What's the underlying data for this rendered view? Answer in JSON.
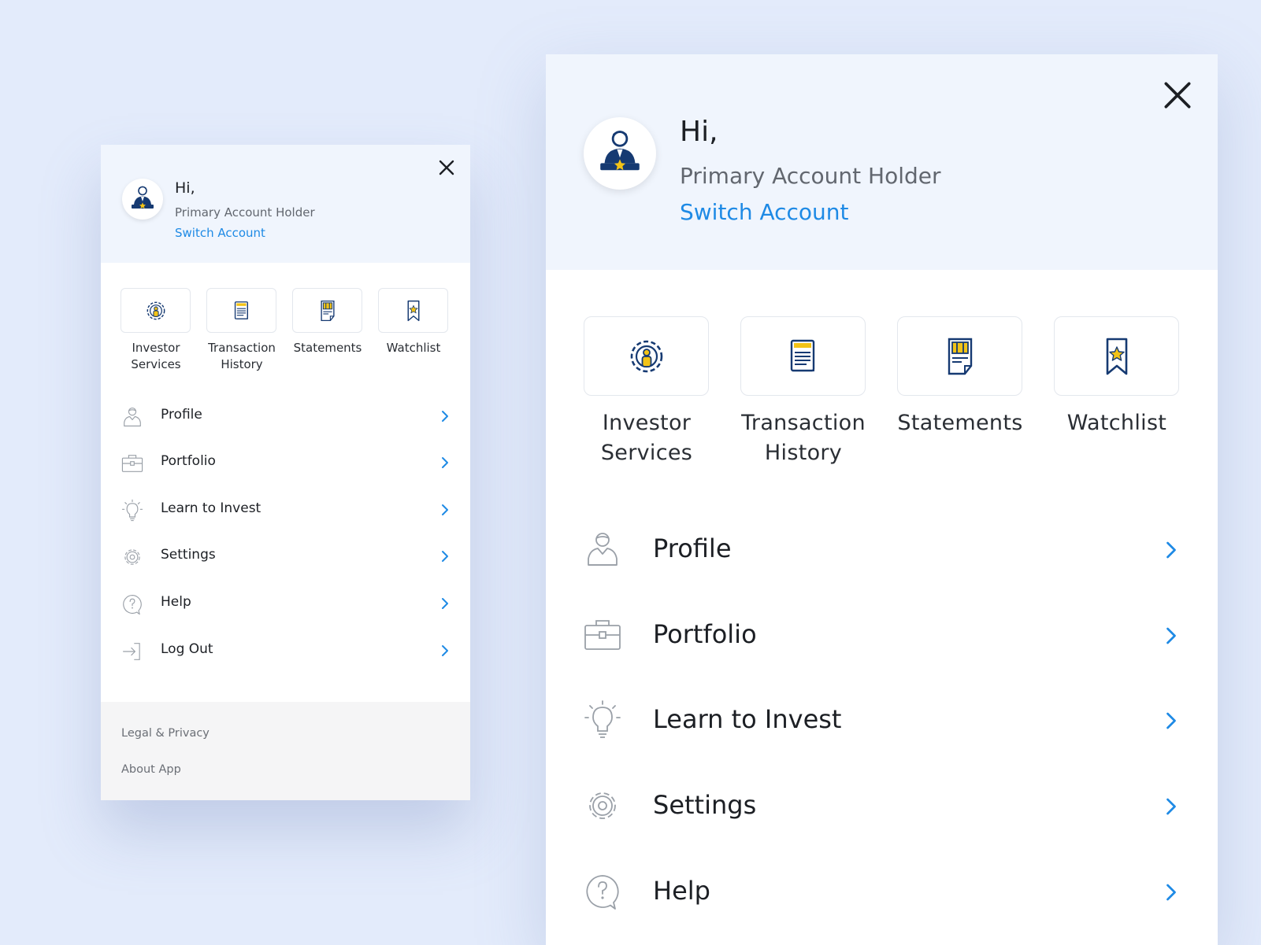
{
  "greeting": "Hi,",
  "account_role": "Primary Account Holder",
  "switch_account": "Switch Account",
  "quick_actions": [
    {
      "label": "Investor Services",
      "icon": "investor-services-icon"
    },
    {
      "label": "Transaction History",
      "icon": "transaction-history-icon"
    },
    {
      "label": "Statements",
      "icon": "statements-icon"
    },
    {
      "label": "Watchlist",
      "icon": "watchlist-icon"
    }
  ],
  "menu": [
    {
      "label": "Profile",
      "icon": "profile-icon"
    },
    {
      "label": "Portfolio",
      "icon": "portfolio-icon"
    },
    {
      "label": "Learn to Invest",
      "icon": "lightbulb-icon"
    },
    {
      "label": "Settings",
      "icon": "gear-icon"
    },
    {
      "label": "Help",
      "icon": "help-icon"
    },
    {
      "label": "Log Out",
      "icon": "logout-icon"
    }
  ],
  "footer": {
    "legal": "Legal & Privacy",
    "about": "About App"
  },
  "colors": {
    "accent": "#1e8ae5",
    "brand_navy": "#163a72",
    "brand_gold": "#f3c316",
    "background": "#e3ebfb",
    "header_bg": "#f0f5fd",
    "footer_bg": "#f5f5f6"
  }
}
